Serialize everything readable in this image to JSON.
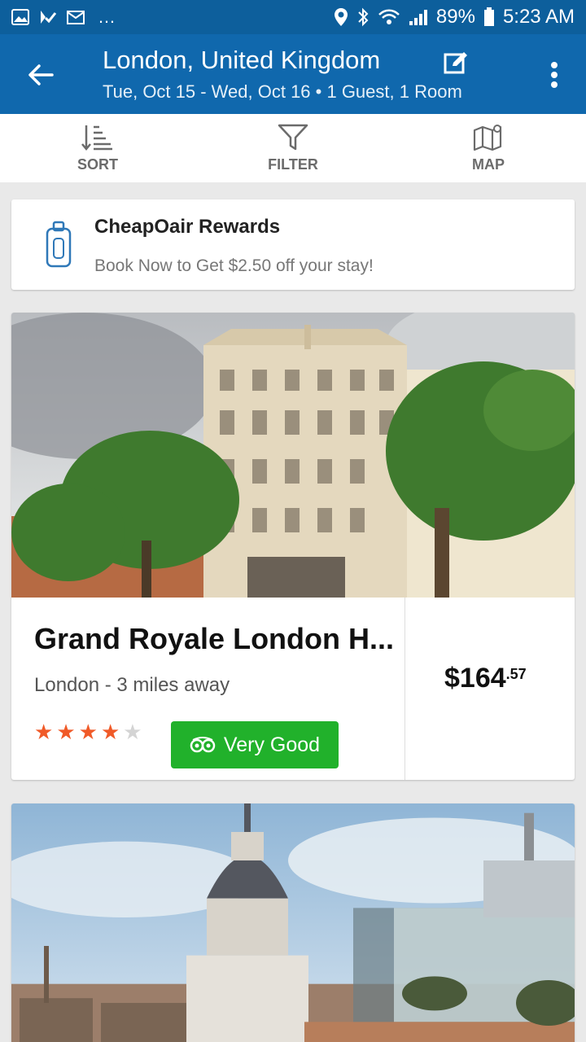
{
  "status_bar": {
    "time": "5:23 AM",
    "battery": "89%",
    "more": "…"
  },
  "header": {
    "title": "London, United Kingdom",
    "subtitle": "Tue, Oct 15 - Wed, Oct 16 •  1 Guest, 1 Room",
    "icons": [
      "back-arrow-icon",
      "edit-icon",
      "more-vert-icon"
    ]
  },
  "toolbar": {
    "sort": "SORT",
    "filter": "FILTER",
    "map": "MAP"
  },
  "rewards": {
    "title": "CheapOair Rewards",
    "subtitle": "Book Now to Get $2.50 off your stay!"
  },
  "hotel": {
    "name": "Grand Royale London H...",
    "distance": "London - 3 miles away",
    "stars_filled": 4,
    "stars_total": 5,
    "rating_label": "Very Good",
    "price_dollars": "$164",
    "price_cents": ".57"
  },
  "colors": {
    "status_bar": "#0d5f9c",
    "app_bar": "#1068ad",
    "badge_green": "#21b12b",
    "star_orange": "#f05a28",
    "star_empty": "#d4d4d4"
  }
}
